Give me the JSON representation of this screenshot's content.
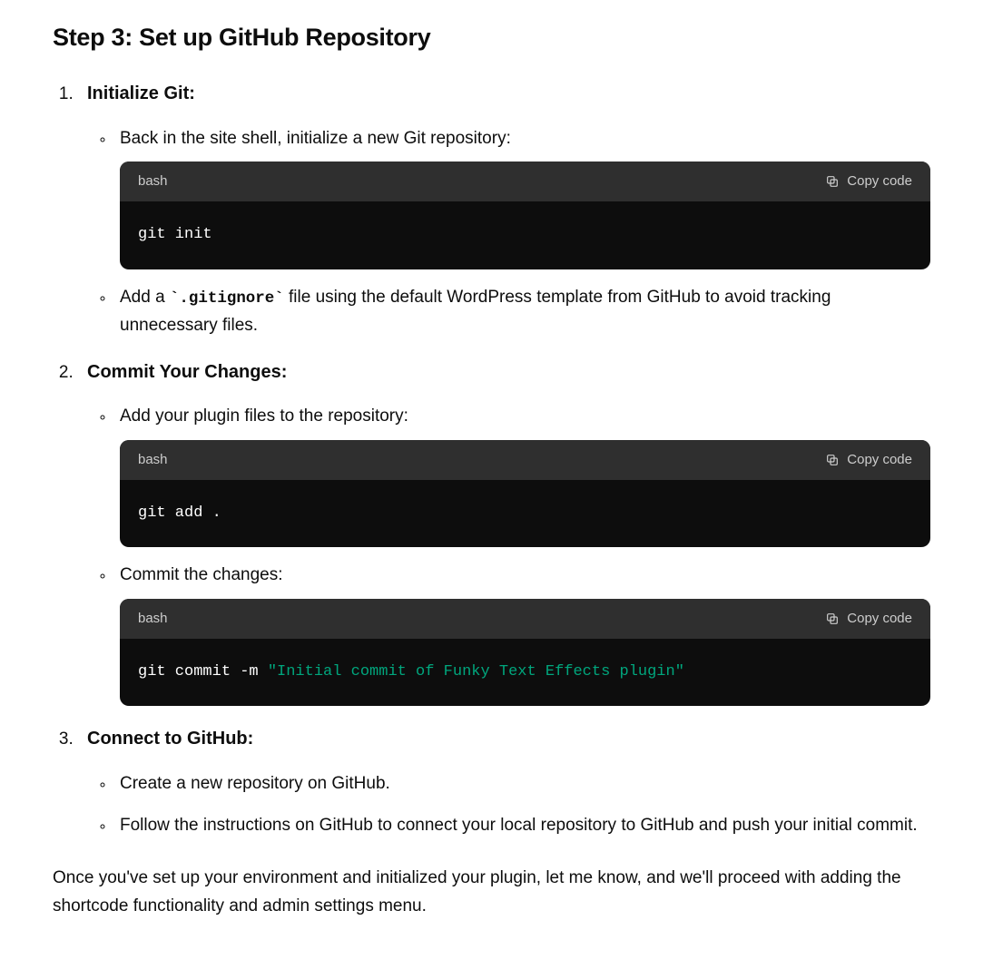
{
  "heading": "Step 3: Set up GitHub Repository",
  "copy_label": "Copy code",
  "items": [
    {
      "title": "Initialize Git:",
      "bullets": [
        {
          "text": "Back in the site shell, initialize a new Git repository:",
          "code": {
            "lang": "bash",
            "plain": "git init"
          }
        },
        {
          "pre": "Add a ",
          "code_inline": "`.gitignore`",
          "post": " file using the default WordPress template from GitHub to avoid tracking unnecessary files."
        }
      ]
    },
    {
      "title": "Commit Your Changes:",
      "bullets": [
        {
          "text": "Add your plugin files to the repository:",
          "code": {
            "lang": "bash",
            "plain": "git add ."
          }
        },
        {
          "text": "Commit the changes:",
          "code": {
            "lang": "bash",
            "cmd": "git commit -m ",
            "str": "\"Initial commit of Funky Text Effects plugin\""
          }
        }
      ]
    },
    {
      "title": "Connect to GitHub:",
      "bullets": [
        {
          "text": "Create a new repository on GitHub."
        },
        {
          "text": "Follow the instructions on GitHub to connect your local repository to GitHub and push your initial commit."
        }
      ]
    }
  ],
  "outro": "Once you've set up your environment and initialized your plugin, let me know, and we'll proceed with adding the shortcode functionality and admin settings menu."
}
